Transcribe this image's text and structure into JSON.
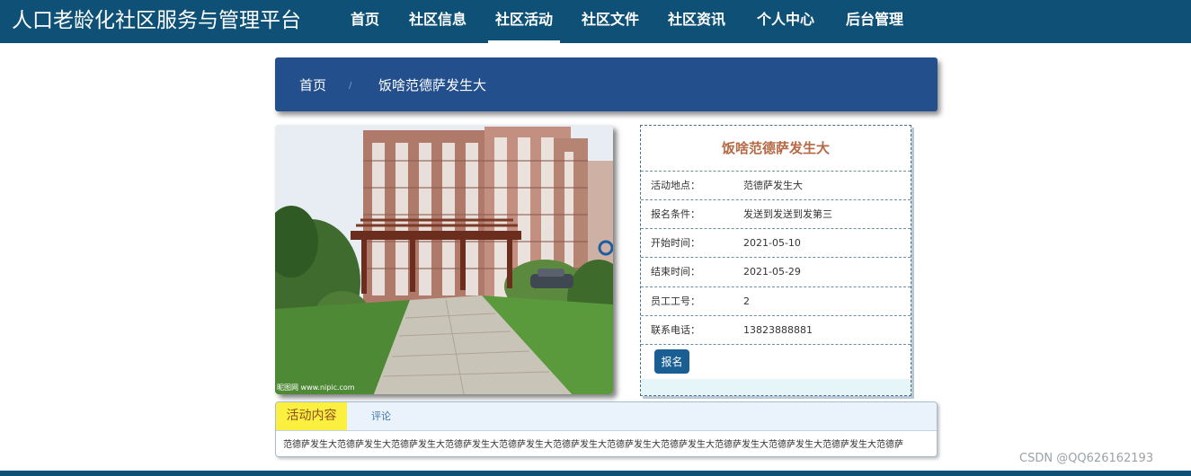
{
  "header": {
    "site_title": "人口老龄化社区服务与管理平台",
    "nav": [
      {
        "label": "首页",
        "active": false
      },
      {
        "label": "社区信息",
        "active": false
      },
      {
        "label": "社区活动",
        "active": true
      },
      {
        "label": "社区文件",
        "active": false
      },
      {
        "label": "社区资讯",
        "active": false
      },
      {
        "label": "个人中心",
        "active": false
      },
      {
        "label": "后台管理",
        "active": false
      }
    ]
  },
  "breadcrumb": {
    "home": "首页",
    "separator": "/",
    "current": "饭啥范德萨发生大"
  },
  "photo": {
    "watermark": "昵图网 www.nipic.com"
  },
  "activity": {
    "title": "饭啥范德萨发生大",
    "fields": [
      {
        "label": "活动地点：",
        "value": "范德萨发生大"
      },
      {
        "label": "报名条件：",
        "value": "发送到发送到发第三"
      },
      {
        "label": "开始时间：",
        "value": "2021-05-10"
      },
      {
        "label": "结束时间：",
        "value": "2021-05-29"
      },
      {
        "label": "员工工号：",
        "value": "2"
      },
      {
        "label": "联系电话：",
        "value": "13823888881"
      }
    ],
    "signup_label": "报名"
  },
  "content": {
    "tab_active": "活动内容",
    "tab_comment": "评论",
    "text": "范德萨发生大范德萨发生大范德萨发生大范德萨发生大范德萨发生大范德萨发生大范德萨发生大范德萨发生大范德萨发生大范德萨发生大范德萨发生大范德萨"
  },
  "footer": {
    "credit": "CSDN @QQ626162193"
  },
  "colors": {
    "header_bg": "#0e5076",
    "breadcrumb_bg": "#234f8d",
    "title_accent": "#b56a45",
    "button_bg": "#1a5f94",
    "tab_active_bg": "#fbef40"
  }
}
